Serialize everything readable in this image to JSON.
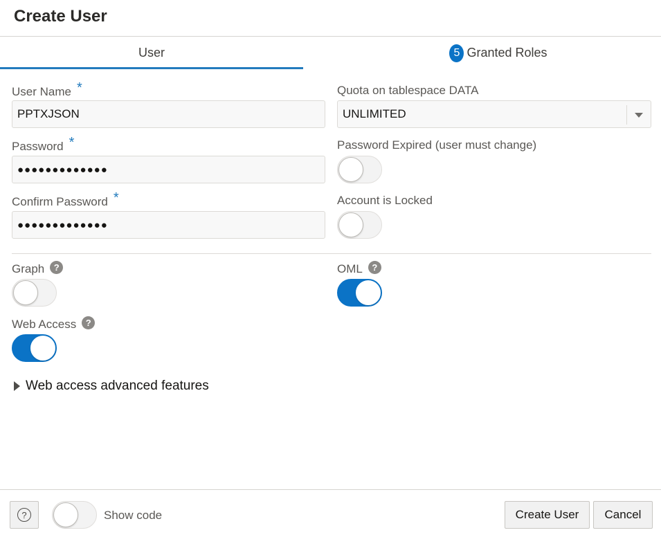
{
  "dialog": {
    "title": "Create User"
  },
  "tabs": {
    "user": "User",
    "roles": {
      "count": "5",
      "label": "Granted Roles"
    }
  },
  "form": {
    "user_name": {
      "label": "User Name",
      "required": "*",
      "value": "PPTXJSON"
    },
    "password": {
      "label": "Password",
      "required": "*",
      "value": "●●●●●●●●●●●●●"
    },
    "confirm_password": {
      "label": "Confirm Password",
      "required": "*",
      "value": "●●●●●●●●●●●●●"
    },
    "quota": {
      "label": "Quota on tablespace DATA",
      "value": "UNLIMITED"
    },
    "password_expired": {
      "label": "Password Expired (user must change)",
      "on": false
    },
    "account_locked": {
      "label": "Account is Locked",
      "on": false
    },
    "graph": {
      "label": "Graph",
      "help": "?",
      "on": false
    },
    "oml": {
      "label": "OML",
      "help": "?",
      "on": true
    },
    "web_access": {
      "label": "Web Access",
      "help": "?",
      "on": true
    },
    "advanced": {
      "label": "Web access advanced features"
    }
  },
  "footer": {
    "help": "?",
    "show_code": {
      "label": "Show code",
      "on": false
    },
    "create_button": "Create User",
    "cancel_button": "Cancel"
  },
  "colors": {
    "accent": "#0b73c6",
    "tab_underline": "#227bbd",
    "required": "#227bbd"
  }
}
